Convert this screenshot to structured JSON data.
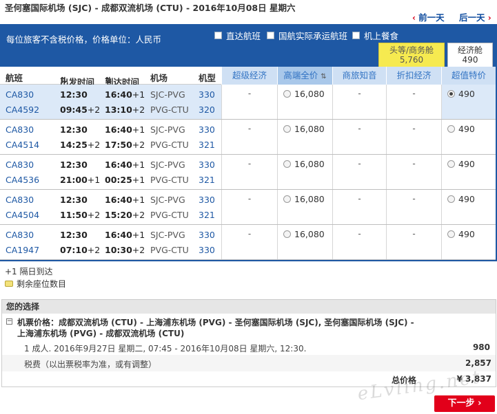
{
  "header": {
    "route_title": "圣何塞国际机场 (SJC) - 成都双流机场 (CTU) - 2016年10月08日 星期六",
    "prev_day": "前一天",
    "next_day": "后一天"
  },
  "banner": {
    "tax_note": "每位旅客不含税价格，价格单位：人民币",
    "filters": [
      "直达航班",
      "国航实际承运航班",
      "机上餐食"
    ],
    "cabins": [
      {
        "name": "头等/商务舱",
        "price": "5,760"
      },
      {
        "name": "经济舱",
        "price": "490"
      }
    ]
  },
  "table": {
    "columns": [
      "航班",
      "出发时间",
      "到达时间",
      "机场",
      "机型"
    ],
    "fare_columns": [
      "超级经济",
      "高端全价",
      "商旅知音",
      "折扣经济",
      "超值特价"
    ],
    "rows": [
      {
        "f1": "CA830",
        "d1": "12:30",
        "d1p": "",
        "a1": "16:40",
        "a1p": "+1",
        "ap1": "SJC-PVG",
        "m1": "330",
        "f2": "CA4592",
        "d2": "09:45",
        "d2p": "+2",
        "a2": "13:10",
        "a2p": "+2",
        "ap2": "PVG-CTU",
        "m2": "320",
        "super": "-",
        "full": "16,080",
        "biz": "-",
        "disc": "-",
        "value": "490",
        "selected": true
      },
      {
        "f1": "CA830",
        "d1": "12:30",
        "d1p": "",
        "a1": "16:40",
        "a1p": "+1",
        "ap1": "SJC-PVG",
        "m1": "330",
        "f2": "CA4514",
        "d2": "14:25",
        "d2p": "+2",
        "a2": "17:50",
        "a2p": "+2",
        "ap2": "PVG-CTU",
        "m2": "321",
        "super": "-",
        "full": "16,080",
        "biz": "-",
        "disc": "-",
        "value": "490",
        "selected": false
      },
      {
        "f1": "CA830",
        "d1": "12:30",
        "d1p": "",
        "a1": "16:40",
        "a1p": "+1",
        "ap1": "SJC-PVG",
        "m1": "330",
        "f2": "CA4536",
        "d2": "21:00",
        "d2p": "+1",
        "a2": "00:25",
        "a2p": "+1",
        "ap2": "PVG-CTU",
        "m2": "321",
        "super": "-",
        "full": "16,080",
        "biz": "-",
        "disc": "-",
        "value": "490",
        "selected": false
      },
      {
        "f1": "CA830",
        "d1": "12:30",
        "d1p": "",
        "a1": "16:40",
        "a1p": "+1",
        "ap1": "SJC-PVG",
        "m1": "330",
        "f2": "CA4504",
        "d2": "11:50",
        "d2p": "+2",
        "a2": "15:20",
        "a2p": "+2",
        "ap2": "PVG-CTU",
        "m2": "321",
        "super": "-",
        "full": "16,080",
        "biz": "-",
        "disc": "-",
        "value": "490",
        "selected": false
      },
      {
        "f1": "CA830",
        "d1": "12:30",
        "d1p": "",
        "a1": "16:40",
        "a1p": "+1",
        "ap1": "SJC-PVG",
        "m1": "330",
        "f2": "CA1947",
        "d2": "07:10",
        "d2p": "+2",
        "a2": "10:30",
        "a2p": "+2",
        "ap2": "PVG-CTU",
        "m2": "330",
        "super": "-",
        "full": "16,080",
        "biz": "-",
        "disc": "-",
        "value": "490",
        "selected": false
      }
    ]
  },
  "legend": {
    "next_day": "+1 隔日到达",
    "seats_left": "剩余座位数目"
  },
  "choice": {
    "title": "您的选择",
    "ticket": "机票价格：成都双流机场 (CTU) - 上海浦东机场 (PVG) - 圣何塞国际机场 (SJC), 圣何塞国际机场 (SJC) - 上海浦东机场 (PVG) - 成都双流机场 (CTU)",
    "pax": "1 成人. 2016年9月27日 星期二, 07:45 - 2016年10月08日 星期六, 12:30.",
    "pax_amount": "980",
    "tax_label": "税费（以出票税率为准，或有调整）",
    "tax_amount": "2,857",
    "total_label": "总价格",
    "total_amount": "¥ 3,837"
  },
  "next_button": "下一步 ›",
  "watermark": "eLvling.net",
  "colors": {
    "brand_blue": "#1e58a4",
    "accent_red": "#e2001a",
    "first_tab": "#f6ea50",
    "selected_row": "#dce9f8"
  }
}
